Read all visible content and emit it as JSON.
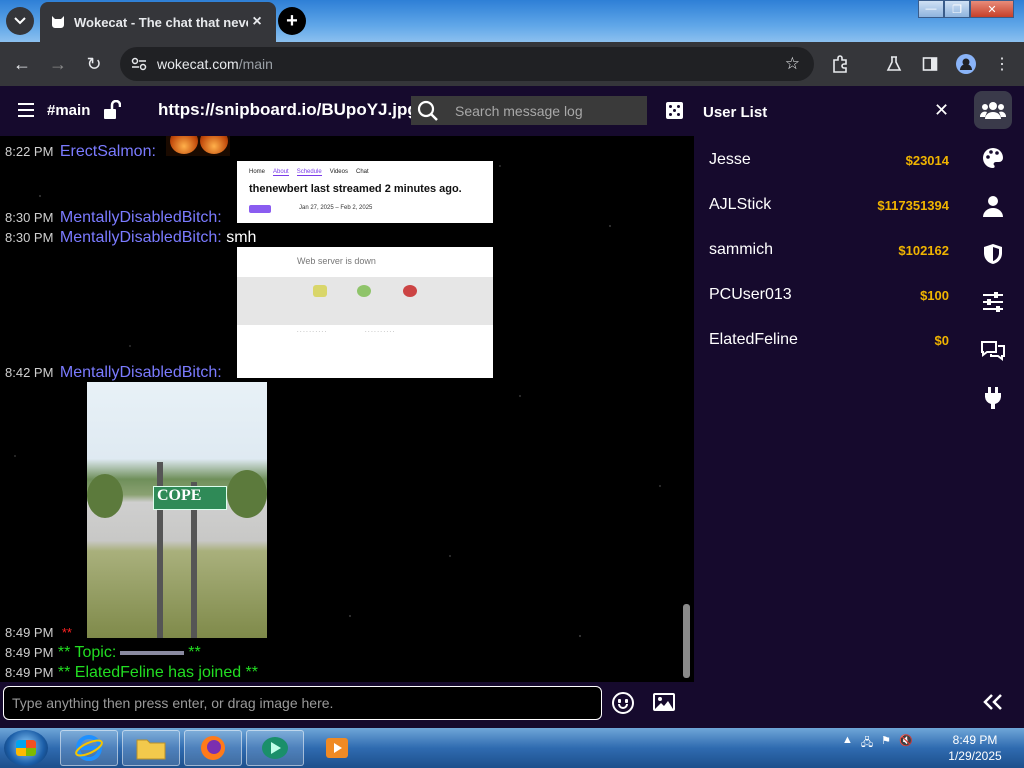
{
  "browser": {
    "tab_title": "Wokecat - The chat that never",
    "url_host": "wokecat.com",
    "url_path": "/main"
  },
  "header": {
    "channel": "#main",
    "topic_url": "https://snipboard.io/BUpoYJ.jpg",
    "search_placeholder": "Search message log"
  },
  "messages": [
    {
      "time": "8:22 PM",
      "nick": "ErectSalmon:",
      "text": ""
    },
    {
      "time": "8:30 PM",
      "nick": "MentallyDisabledBitch:",
      "text": ""
    },
    {
      "time": "8:30 PM",
      "nick": "MentallyDisabledBitch:",
      "text": "smh"
    },
    {
      "time": "8:42 PM",
      "nick": "MentallyDisabledBitch:",
      "text": ""
    },
    {
      "time": "8:49 PM",
      "text": "**"
    },
    {
      "time": "8:49 PM",
      "text_before": "** Topic:",
      "text_after": "**"
    },
    {
      "time": "8:49 PM",
      "text": "** ElatedFeline has joined **"
    }
  ],
  "embeds": {
    "stream_card": {
      "nav": [
        "Home",
        "About",
        "Schedule",
        "Videos",
        "Chat"
      ],
      "headline": "thenewbert last streamed 2 minutes ago.",
      "range": "Jan 27, 2025 – Feb 2, 2025"
    },
    "webdown_card": {
      "title": "Web server is down"
    },
    "photo": {
      "sign_text": "COPE"
    }
  },
  "input": {
    "placeholder": "Type anything then press enter, or drag image here."
  },
  "userlist": {
    "title": "User List",
    "close": "✕",
    "users": [
      {
        "name": "Jesse",
        "balance": "$23014"
      },
      {
        "name": "AJLStick",
        "balance": "$117351394"
      },
      {
        "name": "sammich",
        "balance": "$102162"
      },
      {
        "name": "PCUser013",
        "balance": "$100"
      },
      {
        "name": "ElatedFeline",
        "balance": "$0"
      }
    ]
  },
  "iconbar": [
    "users-icon",
    "palette-icon",
    "user-icon",
    "shield-icon",
    "sliders-icon",
    "chat-bubbles-icon",
    "plug-icon",
    "collapse-icon"
  ],
  "taskbar": {
    "time": "8:49 PM",
    "date": "1/29/2025"
  },
  "colors": {
    "panel_bg": "#160a2d",
    "nick": "#7b7bff",
    "system_msg": "#22dd22",
    "balance": "#f0b400"
  }
}
